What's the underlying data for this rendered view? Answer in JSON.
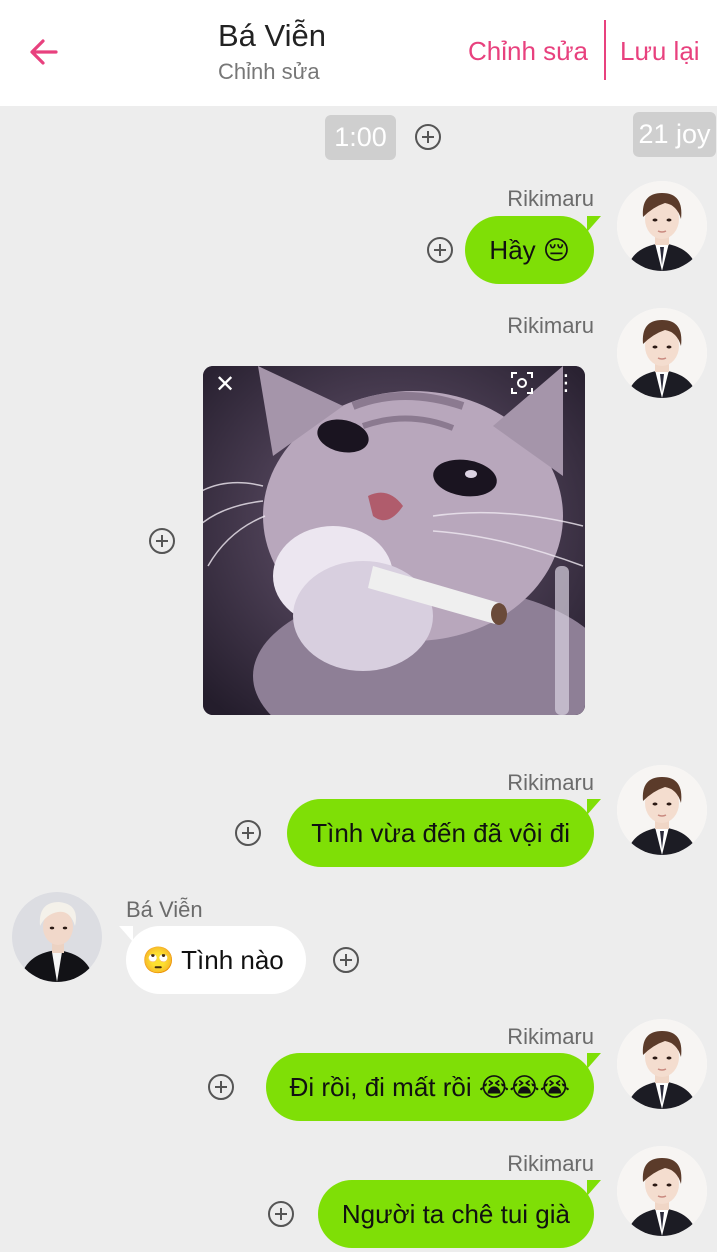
{
  "header": {
    "title": "Bá Viễn",
    "subtitle": "Chỉnh sửa",
    "edit_label": "Chỉnh sửa",
    "save_label": "Lưu lại",
    "accent_color": "#e8417e"
  },
  "chips": {
    "time": "1:00",
    "joy": "21 joy"
  },
  "messages": [
    {
      "sender": "Rikimaru",
      "side": "right",
      "text": "Hầy ",
      "emoji": "😔"
    },
    {
      "sender": "Rikimaru",
      "side": "right",
      "type": "image",
      "image": "cat-smoking-photo"
    },
    {
      "sender": "Rikimaru",
      "side": "right",
      "text": "Tình vừa đến đã vội đi"
    },
    {
      "sender": "Bá Viễn",
      "side": "left",
      "emoji": "🙄",
      "text": " Tình nào"
    },
    {
      "sender": "Rikimaru",
      "side": "right",
      "text": "Đi rồi, đi mất rồi ",
      "emoji": "😭😭😭"
    },
    {
      "sender": "Rikimaru",
      "side": "right",
      "text": "Người ta chê tui già"
    }
  ],
  "colors": {
    "outgoing_bubble": "#7fdf06",
    "incoming_bubble": "#ffffff",
    "background": "#ededed"
  },
  "icons": {
    "back": "back-arrow-icon",
    "add": "add-circle-icon",
    "close": "close-icon",
    "lens": "lens-icon",
    "more": "more-vertical-icon"
  },
  "photo_overlay": {
    "close_glyph": "✕",
    "more_glyph": "⋮"
  }
}
